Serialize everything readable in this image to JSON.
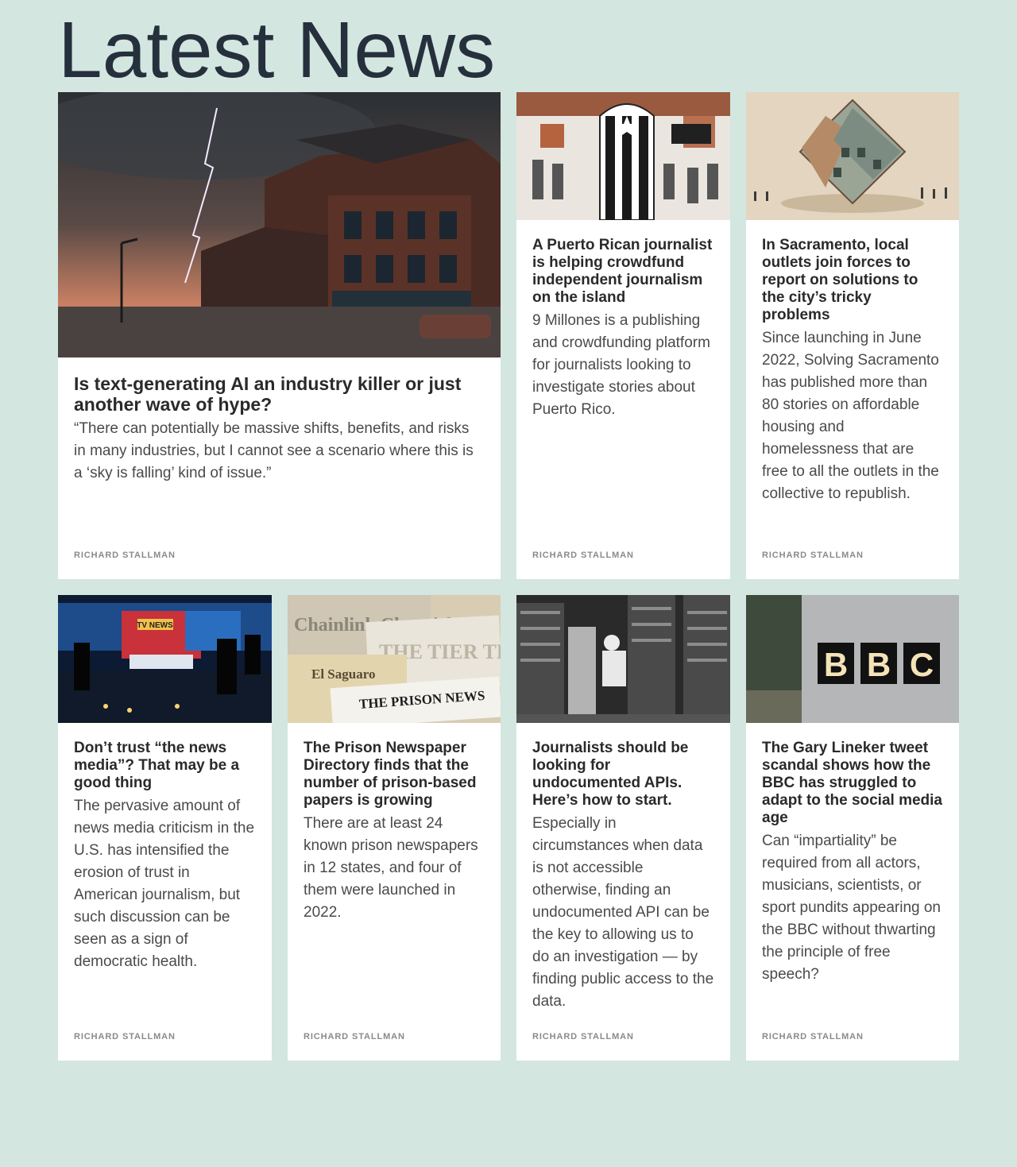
{
  "page": {
    "title": "Latest News"
  },
  "articles": [
    {
      "title": "Is text-generating AI an industry killer or just another wave of hype?",
      "summary": "“There can potentially be massive shifts, benefits, and risks in many industries, but I cannot see a scenario where this is a ‘sky is falling’ kind of issue.”",
      "author": "RICHARD STALLMAN",
      "image_icon": "storm-town-image"
    },
    {
      "title": "A Puerto Rican journalist is helping crowdfund independent journalism on the island",
      "summary": "9 Millones is a publishing and crowdfunding platform for journalists looking to investigate stories about Puerto Rico.",
      "author": "RICHARD STALLMAN",
      "image_icon": "mural-flag-image"
    },
    {
      "title": "In Sacramento, local outlets join forces to report on solutions to the city’s tricky problems",
      "summary": "Since launching in June 2022, Solving Sacramento has published more than 80 stories on affordable housing and homelessness that are free to all the outlets in the collective to republish.",
      "author": "RICHARD STALLMAN",
      "image_icon": "tilted-house-image"
    },
    {
      "title": "Don’t trust “the news media”? That may be a good thing",
      "summary": "The pervasive amount of news media criticism in the U.S. has intensified the erosion of trust in American journalism, but such discussion can be seen as a sign of democratic health.",
      "author": "RICHARD STALLMAN",
      "image_icon": "tv-studio-image",
      "image_text": "TV NEWS"
    },
    {
      "title": "The Prison Newspaper Directory finds that the number of prison-based papers is growing",
      "summary": "There are at least 24 known prison newspapers in 12 states, and four of them were launched in 2022.",
      "author": "RICHARD STALLMAN",
      "image_icon": "newspapers-image",
      "image_text": [
        "Chainlink Chronicle",
        "THE TIER TRIBUNE",
        "El Saguaro",
        "THE PRISON NEWS"
      ]
    },
    {
      "title": "Journalists should be looking for undocumented APIs. Here’s how to start.",
      "summary": "Especially in circumstances when data is not accessible otherwise, finding an undocumented API can be the key to allowing us to do an investigation — by finding public access to the data.",
      "author": "RICHARD STALLMAN",
      "image_icon": "vintage-computer-image"
    },
    {
      "title": "The Gary Lineker tweet scandal shows how the BBC has struggled to adapt to the social media age",
      "summary": "Can “impartiality” be required from all actors, musicians, scientists, or sport pundits appearing on the BBC without thwarting the principle of free speech?",
      "author": "RICHARD STALLMAN",
      "image_icon": "bbc-sign-image",
      "image_text": [
        "B",
        "B",
        "C"
      ]
    }
  ]
}
